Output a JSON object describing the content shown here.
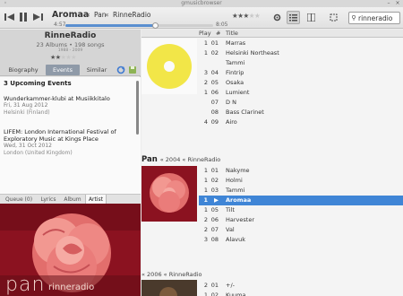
{
  "window": {
    "title": "gmusicbrowser"
  },
  "player": {
    "track_title": "Aromaa",
    "sep": "«",
    "album": "Pan",
    "artist": "RinneRadio",
    "elapsed": "4:57",
    "total": "8:05",
    "progress": 0.61,
    "rating": 3,
    "rating_max": 5
  },
  "search": {
    "value": "rinneradio"
  },
  "artist_panel": {
    "name": "RinneRadio",
    "summary": "23 Albums • 198 songs",
    "years": "1988 - 2009",
    "rating": 2,
    "tabs": [
      "Biography",
      "Events",
      "Similar"
    ],
    "active_tab": "Events"
  },
  "events": {
    "heading": "3 Upcoming Events",
    "items": [
      {
        "title": "Wunderkammer-klubi at Musiikkitalo",
        "date": "Fri, 31 Aug 2012",
        "location": "Helsinki (Finland)"
      },
      {
        "title": "LIFEM: London International Festival of Exploratory Music at Kings Place",
        "date": "Wed, 31 Oct 2012",
        "location": "London (United Kingdom)"
      }
    ]
  },
  "lower_tabs": {
    "items": [
      "Queue (0)",
      "Lyrics",
      "Album",
      "Artist"
    ],
    "active": "Artist"
  },
  "columns": {
    "play": "Play",
    "hash": "#",
    "title": "Title"
  },
  "groups": [
    {
      "album": "",
      "meta": "",
      "rows": [
        {
          "disc": "1",
          "num": "01",
          "title": "Marras"
        },
        {
          "disc": "1",
          "num": "02",
          "title": "Helsinki Northeast"
        },
        {
          "disc": "",
          "num": "",
          "title": "Tammi"
        },
        {
          "disc": "3",
          "num": "04",
          "title": "Fintrip"
        },
        {
          "disc": "2",
          "num": "05",
          "title": "Osaka"
        },
        {
          "disc": "1",
          "num": "06",
          "title": "Lumient"
        },
        {
          "disc": "",
          "num": "07",
          "title": "D N"
        },
        {
          "disc": "",
          "num": "08",
          "title": "Bass Clarinet"
        },
        {
          "disc": "4",
          "num": "09",
          "title": "Airo"
        }
      ]
    },
    {
      "album": "Pan",
      "meta": "« 2004 « RinneRadio",
      "rows": [
        {
          "disc": "1",
          "num": "01",
          "title": "Nakyme"
        },
        {
          "disc": "1",
          "num": "02",
          "title": "Holmi"
        },
        {
          "disc": "1",
          "num": "03",
          "title": "Tammi"
        },
        {
          "disc": "1",
          "num": "▶",
          "title": "Aromaa",
          "selected": true
        },
        {
          "disc": "1",
          "num": "05",
          "title": "Tilt"
        },
        {
          "disc": "2",
          "num": "06",
          "title": "Harvester"
        },
        {
          "disc": "2",
          "num": "07",
          "title": "Val"
        },
        {
          "disc": "3",
          "num": "08",
          "title": "Alavuk"
        }
      ]
    },
    {
      "album": "",
      "meta": "« 2006 « RinneRadio",
      "rows": [
        {
          "disc": "2",
          "num": "01",
          "title": "+/-"
        },
        {
          "disc": "1",
          "num": "02",
          "title": "Kuuma"
        }
      ]
    }
  ],
  "art": {
    "text": "pan",
    "text2": "rinneradio",
    "bg": "#8b1220",
    "flower": "#f08a86",
    "record_color": "#f2e648"
  }
}
